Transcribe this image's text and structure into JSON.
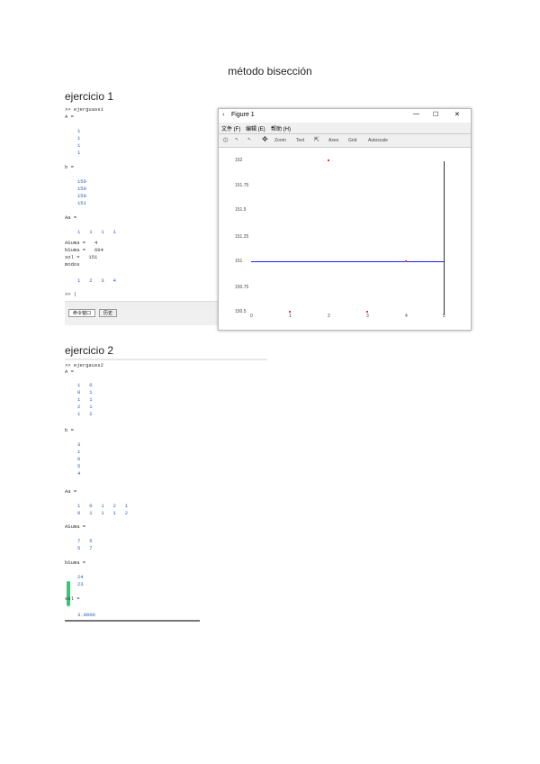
{
  "doc_title": "método bisección",
  "ex1": {
    "heading": "ejercicio 1",
    "lines": [
      ">> ejerguass1",
      "A =",
      "1",
      "1",
      "1",
      "1",
      "b =",
      "150",
      "150",
      "150",
      "151",
      "Aa =",
      "1   1   1   1",
      "ASuma =   4",
      "bSuma =   604",
      "sol =   151",
      "modos",
      "1   2   3   4",
      ">> |"
    ],
    "tabs": [
      "命令窗口",
      "历史"
    ]
  },
  "figure": {
    "title": "Figure 1",
    "menu": [
      "文件 (F)",
      "编辑 (E)",
      "帮助 (H)"
    ],
    "toolbar": [
      "Zoom",
      "Text",
      "Axes",
      "Grid",
      "Autoscale"
    ],
    "window_controls": [
      "—",
      "☐",
      "✕"
    ],
    "yticks": [
      "152",
      "151.75",
      "151.5",
      "151.25",
      "151",
      "150.75",
      "150.5"
    ],
    "xticks": [
      "0",
      "1",
      "2",
      "3",
      "4",
      "5"
    ],
    "line_color": "#1f1fff"
  },
  "ex2": {
    "heading": "ejercicio 2",
    "lines": [
      ">> ejergauss2",
      "A =",
      "1   0",
      "0   1",
      "1   1",
      "2   1",
      "1   2",
      "b =",
      "3",
      "1",
      "6",
      "5",
      "4",
      "Aa =",
      "1   0   1   2   1",
      "0   1   1   1   2",
      "ASuma =",
      "7   5",
      "5   7",
      "bSuma =",
      "24",
      "23",
      "sol =",
      "3.0000"
    ]
  }
}
